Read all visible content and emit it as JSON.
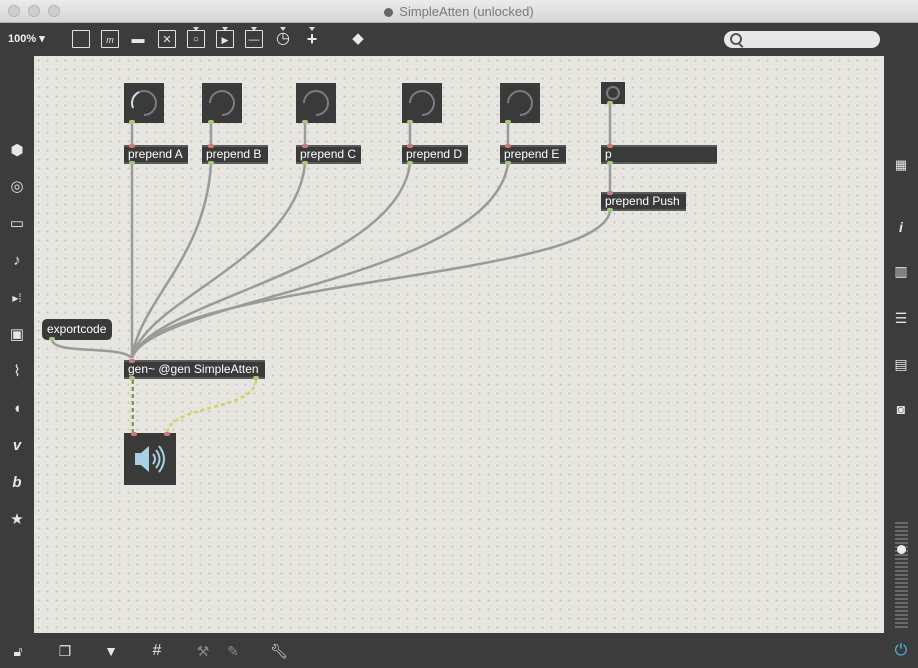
{
  "window": {
    "title": "SimpleAtten (unlocked)"
  },
  "toolbar": {
    "zoom": "100%",
    "icons": [
      "presentation-icon",
      "message-icon",
      "comment-icon",
      "toggle-icon",
      "button-icon",
      "play-icon",
      "slider-icon",
      "dial-icon",
      "add-icon",
      "paint-bucket-icon"
    ]
  },
  "search": {
    "placeholder": ""
  },
  "left_sidebar": [
    "objects-icon",
    "circle-icon",
    "media-icon",
    "music-icon",
    "step-icon",
    "image-icon",
    "attach-icon",
    "plug-icon",
    "vimeo-icon",
    "bandcamp-icon",
    "star-icon"
  ],
  "right_sidebar": [
    "grid-icon",
    "info-icon",
    "book-icon",
    "list-icon",
    "reference-icon",
    "snapshot-icon"
  ],
  "patch": {
    "objects": [
      {
        "id": "pa",
        "text": "prepend A"
      },
      {
        "id": "pb",
        "text": "prepend B"
      },
      {
        "id": "pc",
        "text": "prepend C"
      },
      {
        "id": "pd",
        "text": "prepend D"
      },
      {
        "id": "pe",
        "text": "prepend E"
      },
      {
        "id": "p",
        "text": "p"
      },
      {
        "id": "pp",
        "text": "prepend Push"
      },
      {
        "id": "gen",
        "text": "gen~ @gen SimpleAtten"
      }
    ],
    "message": "exportcode"
  },
  "bottom_bar": [
    "lock-icon",
    "windows-icon",
    "presentation-mode-icon",
    "grid-icon",
    "tool-icon",
    "debug-icon",
    "wrench-icon",
    "power-icon"
  ]
}
